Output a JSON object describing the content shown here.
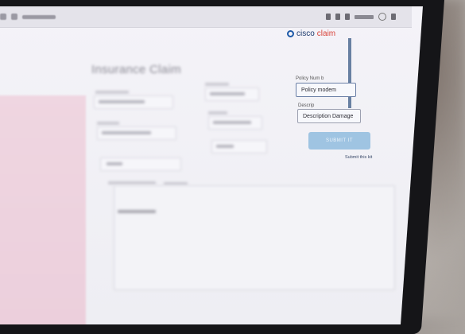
{
  "app": {
    "logo_text_a": "cisco",
    "logo_text_b": "claim"
  },
  "form": {
    "title": "Insurance Claim",
    "policy_label": "Policy Num b",
    "policy_value": "Policy modem",
    "description_label": "Descrip",
    "description_value": "Description Damage",
    "submit_label": "SUBMIT IT",
    "submit_note": "Submit this kit"
  }
}
